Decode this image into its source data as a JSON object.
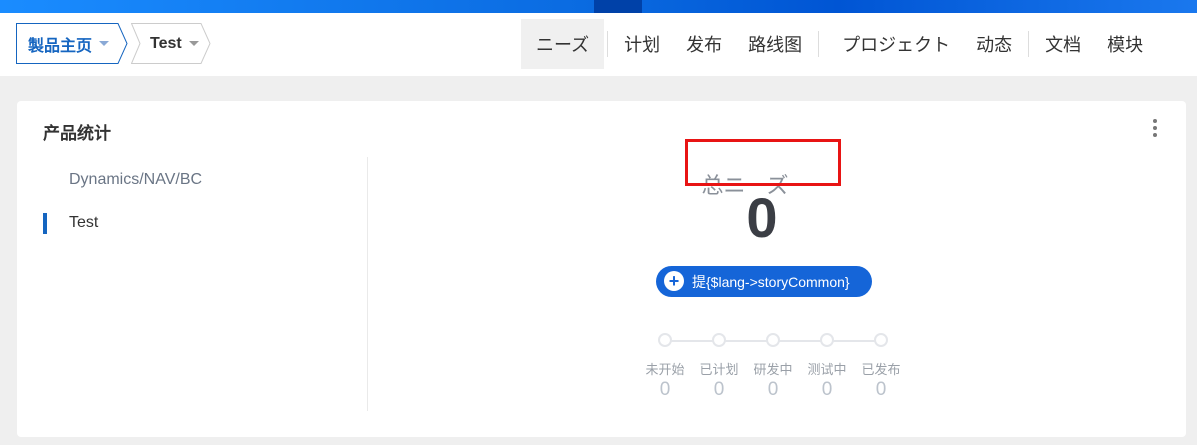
{
  "breadcrumbs": [
    {
      "label": "製品主页"
    },
    {
      "label": "Test"
    }
  ],
  "nav": {
    "items": [
      "ニーズ",
      "计划",
      "发布",
      "路线图",
      "プロジェクト",
      "动态",
      "文档",
      "模块"
    ],
    "active": "ニーズ"
  },
  "card": {
    "title": "产品统计",
    "side_items": [
      "Dynamics/NAV/BC",
      "Test"
    ],
    "selected": "Test",
    "total_label": "总ニーズ",
    "total_value": "0",
    "add_button_label": "提{$lang->storyCommon}",
    "stages": [
      {
        "label": "未开始",
        "value": "0"
      },
      {
        "label": "已计划",
        "value": "0"
      },
      {
        "label": "研发中",
        "value": "0"
      },
      {
        "label": "测试中",
        "value": "0"
      },
      {
        "label": "已发布",
        "value": "0"
      }
    ]
  },
  "colors": {
    "accent": "#1565d8",
    "highlight_box": "#e81414"
  }
}
